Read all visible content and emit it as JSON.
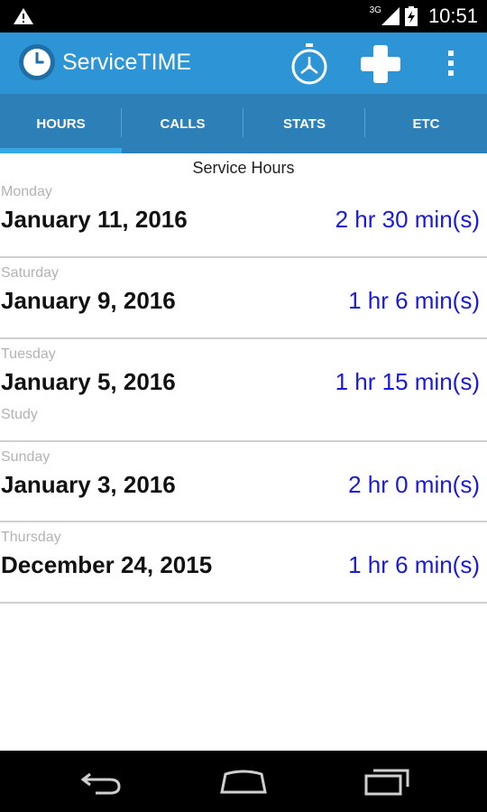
{
  "status_bar": {
    "network_type": "3G",
    "time": "10:51"
  },
  "app_bar": {
    "title": "ServiceTIME",
    "icons": [
      "clock-logo-icon",
      "stopwatch-icon",
      "plus-icon",
      "overflow-menu-icon"
    ]
  },
  "tabs": [
    {
      "label": "HOURS",
      "selected": true
    },
    {
      "label": "CALLS",
      "selected": false
    },
    {
      "label": "STATS",
      "selected": false
    },
    {
      "label": "ETC",
      "selected": false
    }
  ],
  "section_title": "Service Hours",
  "entries": [
    {
      "day": "Monday",
      "date": "January 11, 2016",
      "duration": "2 hr 30 min(s)",
      "note": ""
    },
    {
      "day": "Saturday",
      "date": "January 9, 2016",
      "duration": "1 hr 6 min(s)",
      "note": ""
    },
    {
      "day": "Tuesday",
      "date": "January 5, 2016",
      "duration": "1 hr 15 min(s)",
      "note": "Study"
    },
    {
      "day": "Sunday",
      "date": "January 3, 2016",
      "duration": "2 hr 0 min(s)",
      "note": ""
    },
    {
      "day": "Thursday",
      "date": "December 24, 2015",
      "duration": "1 hr 6 min(s)",
      "note": ""
    }
  ],
  "colors": {
    "action_bar": "#2d95d5",
    "tab_bar": "#2d80b7",
    "tab_indicator": "#36a8ea",
    "duration_text": "#1a1adb"
  }
}
